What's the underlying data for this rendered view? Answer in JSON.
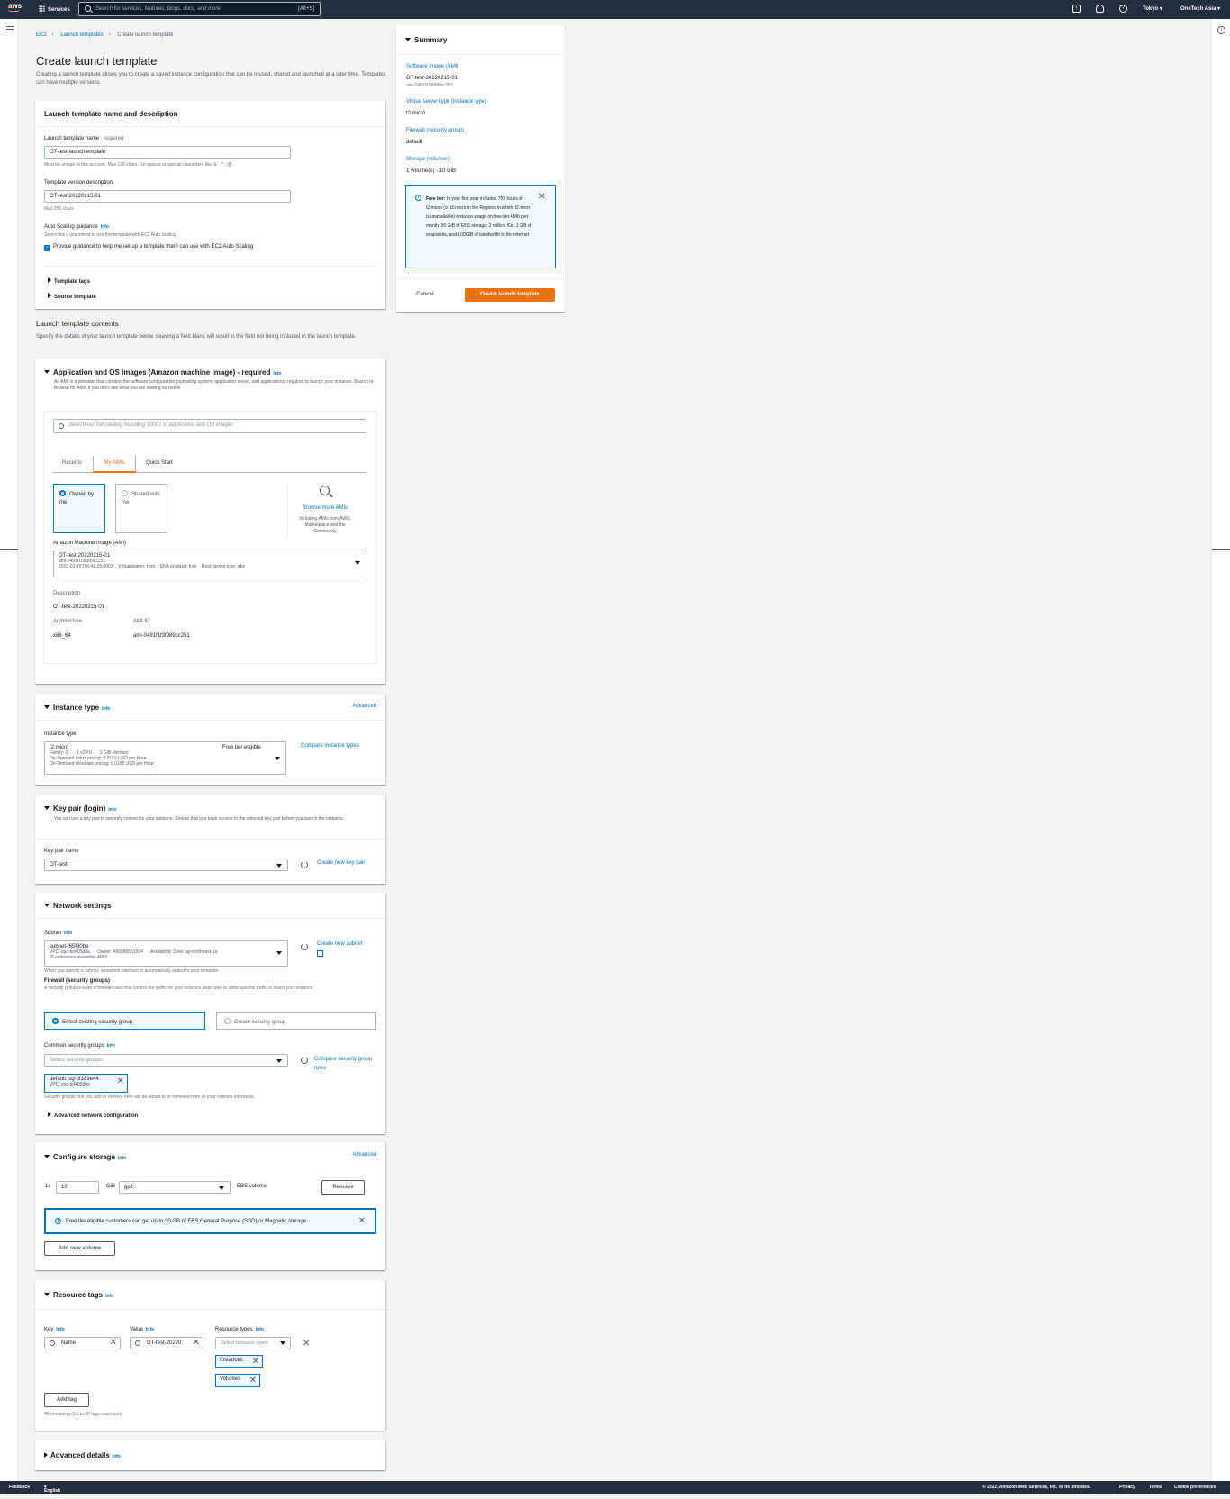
{
  "nav": {
    "logo": "aws",
    "services": "Services",
    "search_placeholder": "Search for services, features, blogs, docs, and more",
    "search_shortcut": "[Alt+S]",
    "region": "Tokyo",
    "account": "OneTech Asia"
  },
  "breadcrumb": [
    "EC2",
    "Launch templates",
    "Create launch template"
  ],
  "page": {
    "title": "Create launch template",
    "description": "Creating a launch template allows you to create a saved instance configuration that can be reused, shared and launched at a later time. Templates can have multiple versions."
  },
  "name_section": {
    "title": "Launch template name and description",
    "name_label": "Launch template name",
    "name_required": "- required",
    "name_value": "OT-test-launchtemplate",
    "name_hint": "Must be unique to this account. Max 128 chars. No spaces or special characters like '&', '*', '@'.",
    "version_label": "Template version description",
    "version_value": "OT-test-20220215-01",
    "version_hint": "Max 255 chars",
    "asg_label": "Auto Scaling guidance",
    "info": "Info",
    "asg_hint": "Select this if you intend to use this template with EC2 Auto Scaling",
    "asg_checkbox": "Provide guidance to help me set up a template that I can use with EC2 Auto Scaling",
    "template_tags": "Template tags",
    "source_template": "Source template"
  },
  "contents": {
    "title": "Launch template contents",
    "description": "Specify the details of your launch template below. Leaving a field blank will result in the field not being included in the launch template."
  },
  "ami": {
    "title": "Application and OS Images (Amazon machine Image) - required",
    "info": "Info",
    "description": "An AMI is a template that contains the software configuration (operating system, application server, and applications) required to launch your instance. Search or Browse for AMIs if you don't see what you are looking for below",
    "search_placeholder": "Search our full catalog including 1000s of application and OS images",
    "tabs": [
      "Recents",
      "My AMIs",
      "Quick Start"
    ],
    "owned": "Owned by me",
    "shared": "Shared with me",
    "browse_more": "Browse more AMIs",
    "browse_hint": "Including AMIs from AWS, Marketplace and the Community",
    "select_label": "Amazon Machine Image (AMI)",
    "selected_name": "OT-test-20220215-01",
    "selected_id": "ami-0491f1f3f989cc251",
    "selected_meta": "2022-02-15T06:41:25.000Z    Virtualization: hvm    ENA enabled: true    Root device type: ebs",
    "desc_label": "Description",
    "desc_value": "OT-test-20220215-01",
    "arch_label": "Architecture",
    "arch_value": "x86_64",
    "amiid_label": "AMI ID",
    "amiid_value": "ami-0491f1f3f989cc251"
  },
  "instance": {
    "title": "Instance type",
    "info": "Info",
    "advanced": "Advanced",
    "label": "Instance type",
    "value": "t2.micro",
    "free": "Free tier eligible",
    "family": "Family: t2      1 vCPU      1 GiB Memory",
    "linux": "On-Demand Linux pricing: 0.0152 USD per Hour",
    "windows": "On-Demand Windows pricing: 0.0198 USD per Hour",
    "compare": "Compare instance types"
  },
  "keypair": {
    "title": "Key pair (login)",
    "info": "Info",
    "description": "You can use a key pair to securely connect to your instance. Ensure that you have access to the selected key pair before you launch the instance.",
    "label": "Key pair name",
    "value": "OT-test",
    "create": "Create new key pair"
  },
  "network": {
    "title": "Network settings",
    "subnet_label": "Subnet",
    "info": "Info",
    "subnet_value": "subnet-f65f80be",
    "subnet_meta1": "VPC: vpc-bd405d8a      Owner: 490586551924      Availability Zone: ap-northeast-1a",
    "subnet_meta2": "IP addresses available: 4065",
    "create_subnet": "Create new subnet",
    "subnet_hint": "When you specify a subnet, a network interface is automatically added to your template.",
    "fw_label": "Firewall (security groups)",
    "fw_hint": "A security group is a set of firewall rules that control the traffic for your instance. Add rules to allow specific traffic to reach your instance.",
    "opt_existing": "Select existing security group",
    "opt_create": "Create security group",
    "common_label": "Common security groups",
    "common_placeholder": "Select security groups",
    "compare_rules": "Compare security group rules",
    "token_name": "default  sg-0f189e44",
    "token_vpc": "VPC: vpc-bd405d8a",
    "sg_hint": "Security groups that you add or remove here will be added to or removed from all your network interfaces.",
    "advanced": "Advanced network configuration"
  },
  "storage": {
    "title": "Configure storage",
    "info": "Info",
    "advanced": "Advanced",
    "prefix": "1x",
    "size": "10",
    "unit": "GiB",
    "type": "gp2",
    "suffix": "EBS volume",
    "remove": "Remove",
    "alert": "Free tier eligible customers can get up to 30 GB of EBS General Purpose (SSD) or Magnetic storage",
    "add_volume": "Add new volume"
  },
  "tags": {
    "title": "Resource tags",
    "info": "Info",
    "key_label": "Key",
    "value_label": "Value",
    "types_label": "Resource types",
    "key_value": "Name",
    "value_value": "OT-test-20220:",
    "types_placeholder": "Select resource types",
    "token1": "Instances",
    "token2": "Volumes",
    "add_tag": "Add tag",
    "remaining": "49 remaining (Up to 50 tags maximum)"
  },
  "advanced_details": {
    "title": "Advanced details",
    "info": "Info"
  },
  "summary": {
    "title": "Summary",
    "ami_label": "Software Image (AMI)",
    "ami_value": "OT-test-20220215-01",
    "ami_id": "ami-0491f1f3f989cc251",
    "type_label": "Virtual server type (instance type)",
    "type_value": "t2.micro",
    "fw_label": "Firewall (security group)",
    "fw_value": "default",
    "storage_label": "Storage (volumes)",
    "storage_value": "1 volume(s) - 10 GiB",
    "free_title": "Free tier:",
    "free_text": "In your first year includes 750 hours of t2.micro (or t3.micro in the Regions in which t2.micro is unavailable) instance usage on free tier AMIs per month, 30 GiB of EBS storage, 2 million IOs, 1 GB of snapshots, and 100 GB of bandwidth to the internet",
    "cancel": "Cancel",
    "create": "Create launch template"
  },
  "footer": {
    "feedback": "Feedback",
    "language": "English (US)",
    "copyright": "© 2022, Amazon Web Services, Inc. or its affiliates.",
    "privacy": "Privacy",
    "terms": "Terms",
    "cookies": "Cookie preferences"
  }
}
